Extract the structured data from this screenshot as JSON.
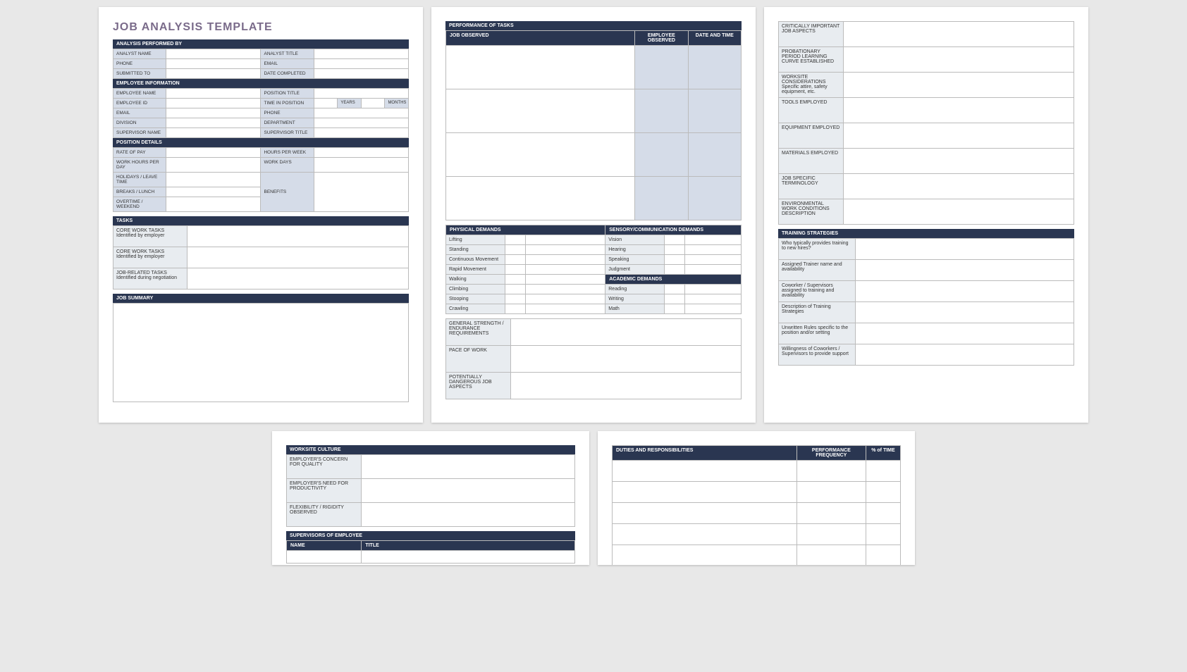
{
  "title": "JOB ANALYSIS TEMPLATE",
  "s1": {
    "h": "ANALYSIS PERFORMED BY",
    "r": [
      [
        "ANALYST NAME",
        "ANALYST TITLE"
      ],
      [
        "PHONE",
        "EMAIL"
      ],
      [
        "SUBMITTED TO",
        "DATE COMPLETED"
      ]
    ]
  },
  "s2": {
    "h": "EMPLOYEE INFORMATION",
    "r": [
      [
        "EMPLOYEE NAME",
        "POSITION TITLE"
      ],
      [
        "EMPLOYEE ID",
        "TIME IN POSITION"
      ],
      [
        "EMAIL",
        "PHONE"
      ],
      [
        "DIVISION",
        "DEPARTMENT"
      ],
      [
        "SUPERVISOR NAME",
        "SUPERVISOR TITLE"
      ]
    ],
    "years": "YEARS",
    "months": "MONTHS"
  },
  "s3": {
    "h": "POSITION DETAILS",
    "left": [
      "RATE OF PAY",
      "WORK HOURS PER DAY",
      "HOLIDAYS / LEAVE TIME",
      "BREAKS / LUNCH",
      "OVERTIME / WEEKEND"
    ],
    "right": [
      "HOURS PER WEEK",
      "WORK DAYS",
      "BENEFITS"
    ]
  },
  "s4": {
    "h": "TASKS",
    "r": [
      "CORE WORK TASKS Identified by employer",
      "CORE WORK TASKS Identified by employer",
      "JOB-RELATED TASKS Identified during negotiation"
    ]
  },
  "s5": {
    "h": "JOB SUMMARY"
  },
  "p2": {
    "h": "PERFORMANCE OF TASKS",
    "cols": [
      "JOB OBSERVED",
      "EMPLOYEE OBSERVED",
      "DATE AND TIME"
    ]
  },
  "pd": {
    "h": "PHYSICAL DEMANDS",
    "items": [
      "Lifting",
      "Standing",
      "Continuous Movement",
      "Rapid Movement",
      "Walking",
      "Climbing",
      "Stooping",
      "Crawling"
    ]
  },
  "sd": {
    "h": "SENSORY/COMMUNICATION DEMANDS",
    "items": [
      "Vision",
      "Hearing",
      "Speaking",
      "Judgment"
    ]
  },
  "ad": {
    "h": "ACADEMIC DEMANDS",
    "items": [
      "Reading",
      "Writing",
      "Math"
    ]
  },
  "gs": [
    "GENERAL STRENGTH / ENDURANCE REQUIREMENTS",
    "PACE OF WORK",
    "POTENTIALLY DANGEROUS JOB ASPECTS"
  ],
  "p3a": [
    "CRITICALLY IMPORTANT JOB ASPECTS",
    "PROBATIONARY PERIOD LEARNING CURVE ESTABLISHED",
    "WORKSITE CONSIDERATIONS Specific attire, safety equipment, etc.",
    "TOOLS EMPLOYED",
    "EQUIPMENT EMPLOYED",
    "MATERIALS EMPLOYED",
    "JOB SPECIFIC TERMINOLOGY",
    "ENVIRONMENTAL WORK CONDITIONS DESCRIPTION"
  ],
  "ts": {
    "h": "TRAINING STRATEGIES",
    "r": [
      "Who typically provides training to new hires?",
      "Assigned Trainer name and availability",
      "Coworker / Supervisors assigned to training and availability",
      "Description of Training Strategies",
      "Unwritten Rules specific to the position and/or setting",
      "Willingness of Coworkers / Supervisors to provide support"
    ]
  },
  "wc": {
    "h": "WORKSITE CULTURE",
    "r": [
      "EMPLOYER'S CONCERN FOR QUALITY",
      "EMPLOYER'S NEED FOR PRODUCTIVITY",
      "FLEXIBILITY / RIGIDITY OBSERVED"
    ]
  },
  "sup": {
    "h": "SUPERVISORS OF EMPLOYEE",
    "cols": [
      "NAME",
      "TITLE"
    ]
  },
  "dr": {
    "h": "DUTIES AND RESPONSIBILITIES",
    "cols": [
      "PERFORMANCE FREQUENCY",
      "% of TIME"
    ]
  }
}
